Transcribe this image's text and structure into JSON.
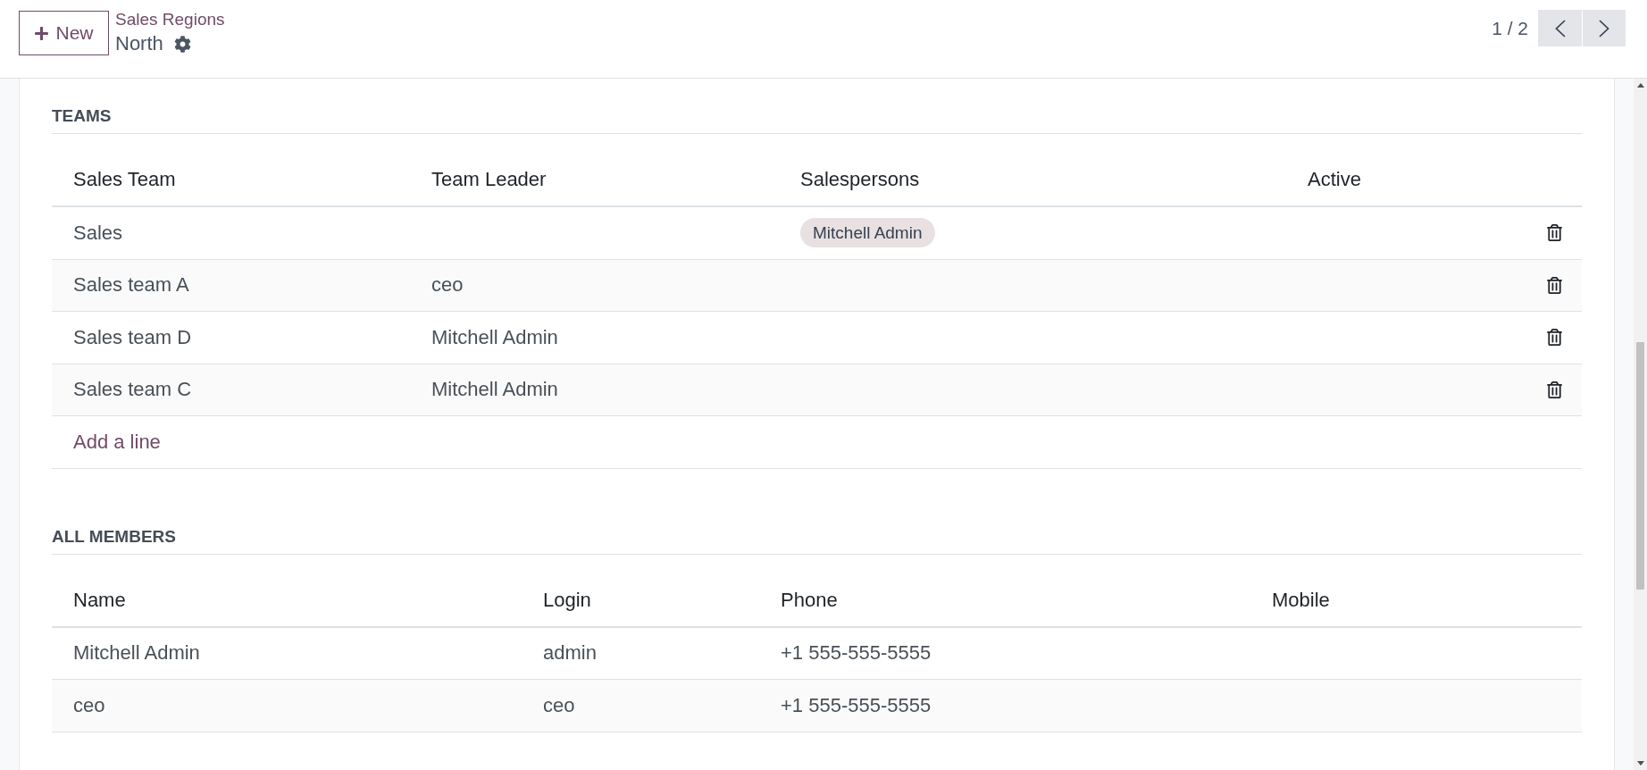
{
  "toolbar": {
    "new_button": "New",
    "breadcrumb": "Sales Regions",
    "record_name": "North",
    "pager": "1 / 2"
  },
  "teams": {
    "title": "TEAMS",
    "columns": [
      "Sales Team",
      "Team Leader",
      "Salespersons",
      "Active"
    ],
    "rows": [
      {
        "sales_team": "Sales",
        "salespersons": [
          "Mitchell Admin"
        ]
      },
      {
        "sales_team": "Sales team A",
        "team_leader": "ceo"
      },
      {
        "sales_team": "Sales team D",
        "team_leader": "Mitchell Admin"
      },
      {
        "sales_team": "Sales team C",
        "team_leader": "Mitchell Admin"
      }
    ],
    "add_line": "Add a line"
  },
  "all_members": {
    "title": "ALL MEMBERS",
    "columns": [
      "Name",
      "Login",
      "Phone",
      "Mobile"
    ],
    "rows": [
      {
        "name": "Mitchell Admin",
        "login": "admin",
        "phone": "+1 555-555-5555"
      },
      {
        "name": "ceo",
        "login": "ceo",
        "phone": "+1 555-555-5555"
      }
    ]
  }
}
